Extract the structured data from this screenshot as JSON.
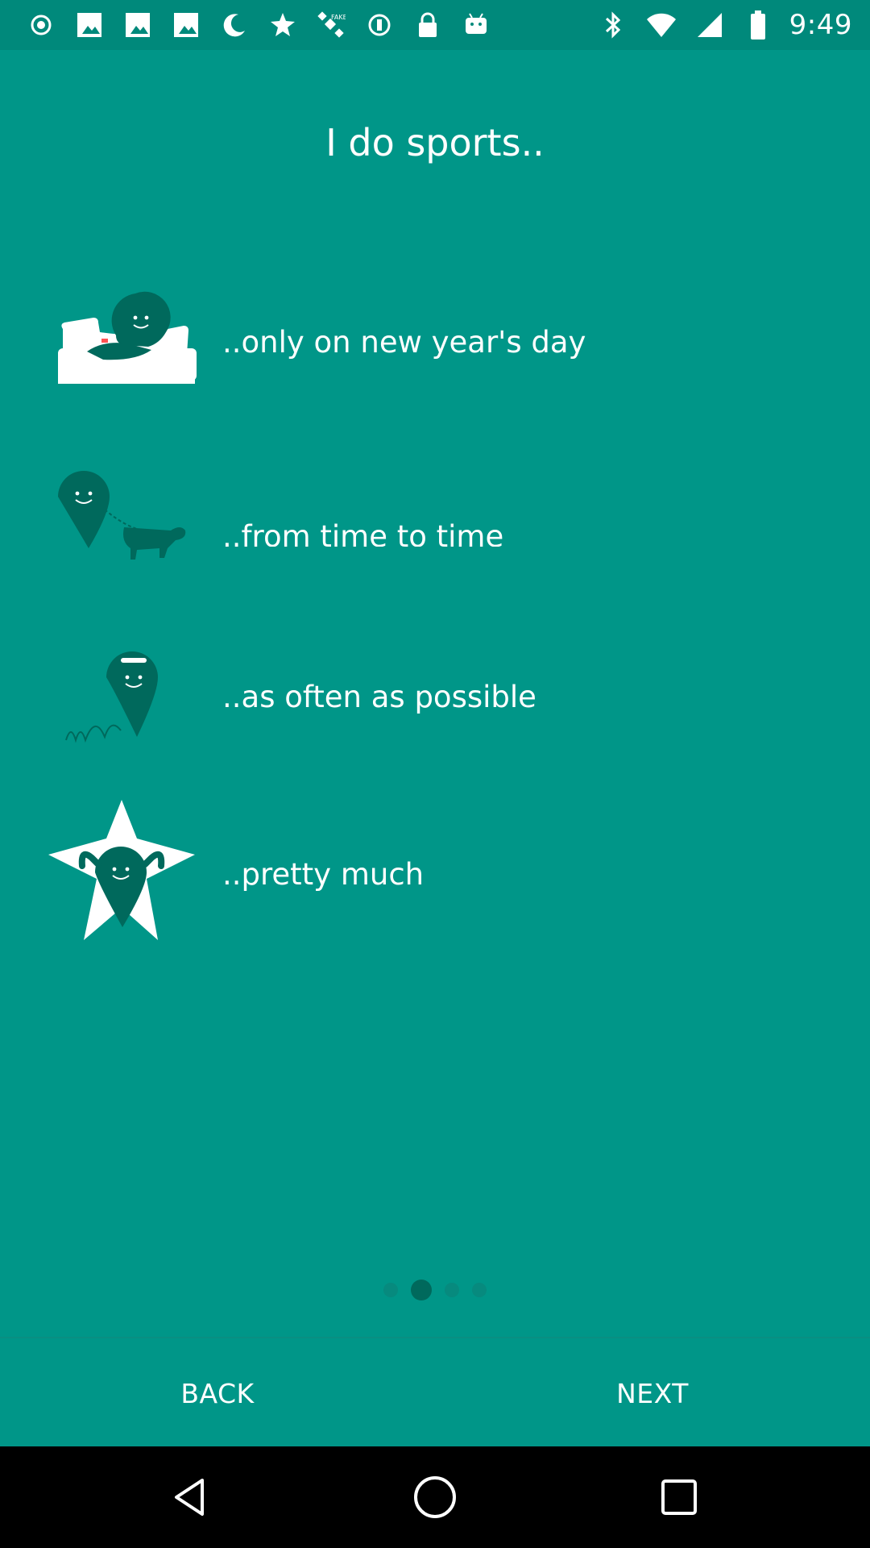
{
  "status_bar": {
    "time": "9:49",
    "left_icons": [
      "record-icon",
      "photo-icon",
      "photo-icon",
      "photo-icon",
      "moon-icon",
      "star-icon",
      "satellite-icon",
      "circle-icon",
      "lock-icon",
      "android-icon"
    ],
    "right_icons": [
      "bluetooth-icon",
      "wifi-icon",
      "signal-icon",
      "battery-icon"
    ]
  },
  "screen": {
    "title": "I do sports..",
    "options": [
      {
        "label": "..only on new year's day",
        "icon": "couch-character-icon"
      },
      {
        "label": "..from time to time",
        "icon": "dog-walk-character-icon"
      },
      {
        "label": "..as often as possible",
        "icon": "jumping-character-icon"
      },
      {
        "label": "..pretty much",
        "icon": "star-athlete-character-icon"
      }
    ],
    "pager": {
      "pages": 4,
      "current": 2
    }
  },
  "buttons": {
    "back": "BACK",
    "next": "NEXT"
  },
  "colors": {
    "background": "#009688",
    "status_bar": "#00897B",
    "character": "#00695C",
    "text": "#FFFFFF"
  }
}
